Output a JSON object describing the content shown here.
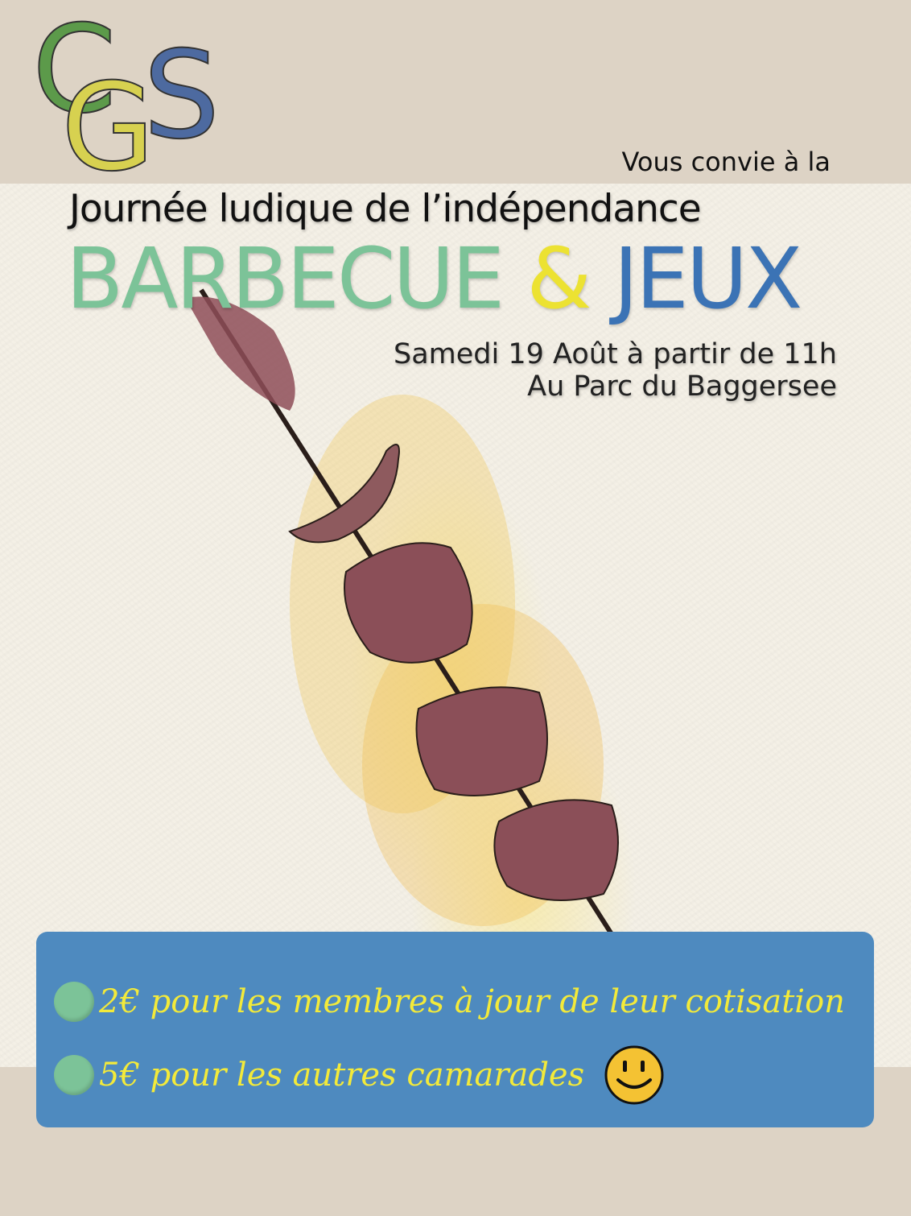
{
  "logo": {
    "name": "CGS logo",
    "letters": [
      "C",
      "G",
      "S"
    ],
    "colors": [
      "#5c9a4a",
      "#d7d150",
      "#4d6aa0"
    ]
  },
  "header": {
    "invite": "Vous convie à la",
    "event_title": "Journée ludique de l’indépendance",
    "headline": {
      "word1": "BARBECUE",
      "amp": "&",
      "word2": "JEUX"
    },
    "date": "Samedi 19 Août à partir de 11h",
    "place": "Au Parc du Baggersee"
  },
  "prices": [
    {
      "text": "2€ pour les membres à jour de leur cotisation"
    },
    {
      "text": "5€ pour les autres camarades"
    }
  ],
  "icons": {
    "bullet": "green-dot-icon",
    "smiley": "smiley-face-icon"
  },
  "colors": {
    "beige": "#ddd3c5",
    "paper": "#f4f0e6",
    "green": "#7cc398",
    "yellow": "#ece232",
    "blue": "#3b73b5",
    "box": "#4e8abf",
    "price_text": "#f3ea3a"
  }
}
